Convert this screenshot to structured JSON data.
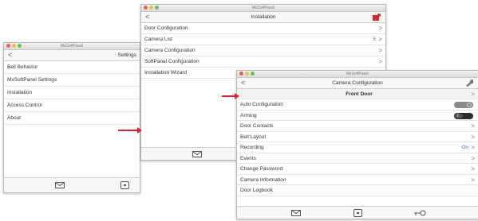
{
  "window1": {
    "window_title": "MxSoftPanel",
    "nav_title": "Settings",
    "back": "<",
    "items": [
      {
        "label": "Bell Behavior"
      },
      {
        "label": "MxSoftPanel Settings"
      },
      {
        "label": "Installation"
      },
      {
        "label": "Access Control"
      },
      {
        "label": "About"
      }
    ]
  },
  "window2": {
    "window_title": "MxSoftPanel",
    "nav_title": "Installation",
    "back": "<",
    "items": [
      {
        "label": "Door Configuration",
        "chevron": ">"
      },
      {
        "label": "Camera List",
        "value": "5",
        "chevron": ">"
      },
      {
        "label": "Camera Configuration",
        "chevron": ">"
      },
      {
        "label": "SoftPanel Configuration",
        "chevron": ">"
      },
      {
        "label": "Installation Wizard",
        "chevron": ">"
      }
    ]
  },
  "window3": {
    "window_title": "MxSoftPanel",
    "nav_title": "Camera Configuration",
    "back": "<",
    "camera_selector": {
      "label": "Front Door",
      "chevron": ">"
    },
    "items": [
      {
        "label": "Auto Configuration"
      },
      {
        "label": "Arming",
        "toggle_text": "I"
      },
      {
        "label": "Door Contacts",
        "chevron": ">"
      },
      {
        "label": "Bell Layout",
        "chevron": ">"
      },
      {
        "label": "Recording",
        "value": "On",
        "chevron": ">"
      },
      {
        "label": "Events",
        "chevron": ">"
      },
      {
        "label": "Change Password",
        "chevron": ">"
      },
      {
        "label": "Camera Information",
        "chevron": ">"
      },
      {
        "label": "Door Logbook"
      }
    ]
  },
  "colors": {
    "arrow": "#e0202d",
    "accent_value": "#3b6fd6",
    "toggle_off": "#8a8a8a",
    "toggle_on": "#2b2b2b"
  },
  "icons": [
    "envelope-icon",
    "square-icon",
    "key-icon",
    "wrench-icon",
    "alert-icon"
  ]
}
